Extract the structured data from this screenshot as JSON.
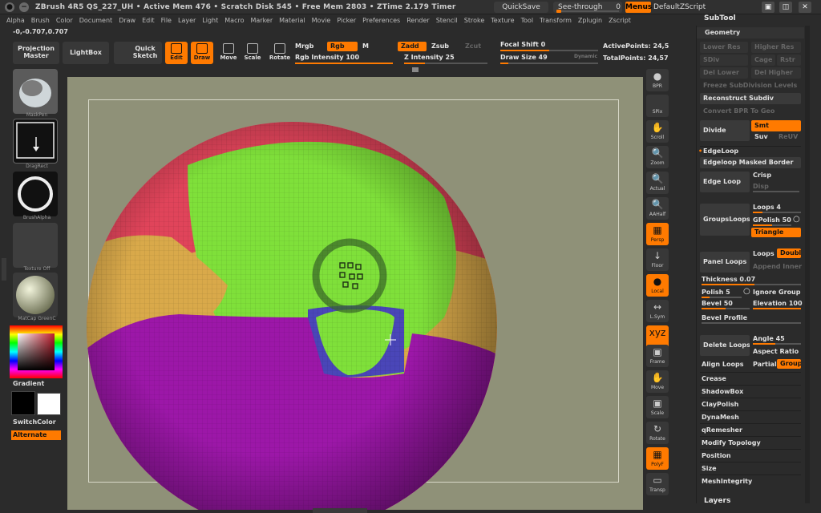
{
  "titlebar": {
    "title": "ZBrush 4R5   QS_227_UH  • Active Mem 476 • Scratch Disk 545 • Free Mem 2803 • ZTime 2.179 Timer",
    "quicksave": "QuickSave",
    "seethrough_label": "See-through",
    "seethrough_value": "0",
    "seethrough_level": 0,
    "menus": "Menus",
    "default_script": "DefaultZScript"
  },
  "menubar": [
    "Alpha",
    "Brush",
    "Color",
    "Document",
    "Draw",
    "Edit",
    "File",
    "Layer",
    "Light",
    "Macro",
    "Marker",
    "Material",
    "Movie",
    "Picker",
    "Preferences",
    "Render",
    "Stencil",
    "Stroke",
    "Texture",
    "Tool",
    "Transform",
    "Zplugin",
    "Zscript"
  ],
  "subtool_header": "SubTool",
  "coords": "-0,-0.707,0.707",
  "toolbar": {
    "projection_master": "Projection Master",
    "lightbox": "LightBox",
    "quick_sketch": "Quick Sketch",
    "edit": "Edit",
    "draw": "Draw",
    "move": "Move",
    "scale": "Scale",
    "rotate": "Rotate",
    "mrgb": "Mrgb",
    "rgb": "Rgb",
    "m": "M",
    "zadd": "Zadd",
    "zsub": "Zsub",
    "zcut": "Zcut",
    "rgb_intensity_label": "Rgb Intensity",
    "rgb_intensity": "100",
    "rgb_intensity_fraction": 1.0,
    "z_intensity_label": "Z Intensity",
    "z_intensity": "25",
    "z_intensity_fraction": 0.25,
    "focal_shift_label": "Focal Shift",
    "focal_shift": "0",
    "focal_shift_fraction": 0.5,
    "draw_size_label": "Draw Size",
    "draw_size": "49",
    "draw_size_fraction": 0.08,
    "dynamic": "Dynamic",
    "active_points_label": "ActivePoints:",
    "active_points": "24,5",
    "total_points_label": "TotalPoints:",
    "total_points": "24,57"
  },
  "left_shelf": {
    "brush_label": "MaskPen",
    "stroke_label": "DragRect",
    "alpha_label": "BrushAlpha",
    "texture_label": "Texture Off",
    "material_label": "MatCap GreenC",
    "gradient": "Gradient",
    "switchcolor": "SwitchColor",
    "alternate": "Alternate"
  },
  "right_shelf": [
    {
      "glyph": "●",
      "label": "BPR",
      "orange": false
    },
    {
      "glyph": "",
      "label": "SPix",
      "orange": false
    },
    {
      "glyph": "✋",
      "label": "Scroll",
      "orange": false
    },
    {
      "glyph": "🔍",
      "label": "Zoom",
      "orange": false
    },
    {
      "glyph": "🔍",
      "label": "Actual",
      "orange": false
    },
    {
      "glyph": "🔍",
      "label": "AAHalf",
      "orange": false
    },
    {
      "glyph": "▦",
      "label": "Persp",
      "orange": true
    },
    {
      "glyph": "↓",
      "label": "Floor",
      "orange": false
    },
    {
      "glyph": "●",
      "label": "Local",
      "orange": true
    },
    {
      "glyph": "↔",
      "label": "L.Sym",
      "orange": false
    },
    {
      "glyph": "xyz",
      "label": "",
      "orange": true
    },
    {
      "glyph": "▣",
      "label": "Frame",
      "orange": false
    },
    {
      "glyph": "✋",
      "label": "Move",
      "orange": false
    },
    {
      "glyph": "▣",
      "label": "Scale",
      "orange": false
    },
    {
      "glyph": "↻",
      "label": "Rotate",
      "orange": false
    },
    {
      "glyph": "▦",
      "label": "PolyF",
      "orange": true
    },
    {
      "glyph": "▭",
      "label": "Transp",
      "orange": false
    }
  ],
  "panel": {
    "geometry": "Geometry",
    "lower_res": "Lower Res",
    "higher_res": "Higher Res",
    "sdiv": "SDiv",
    "cage": "Cage",
    "rstr": "Rstr",
    "del_lower": "Del Lower",
    "del_higher": "Del Higher",
    "freeze": "Freeze SubDivision Levels",
    "reconstruct": "Reconstruct Subdiv",
    "convert_bpr": "Convert BPR To Geo",
    "divide": "Divide",
    "smt": "Smt",
    "suv": "Suv",
    "reuv": "ReUV",
    "edgeloop": "EdgeLoop",
    "edgeloop_masked": "Edgeloop Masked Border",
    "edge_loop": "Edge Loop",
    "crisp": "Crisp",
    "disp": "Disp",
    "groupsloops": "GroupsLoops",
    "loops_label": "Loops",
    "loops": "4",
    "gpolish_label": "GPolish",
    "gpolish": "50",
    "triangle": "Triangle",
    "panel_loops": "Panel Loops",
    "loops2_label": "Loops",
    "double": "Double",
    "append_inner": "Append Inner",
    "thickness_label": "Thickness",
    "thickness": "0.07",
    "polish_label": "Polish",
    "polish": "5",
    "ignore_groups": "Ignore Group",
    "bevel_label": "Bevel",
    "bevel": "50",
    "elevation_label": "Elevation",
    "elevation": "100",
    "bevel_profile": "Bevel Profile",
    "delete_loops": "Delete Loops",
    "angle_label": "Angle",
    "angle": "45",
    "aspect_ratio": "Aspect Ratio",
    "align_loops": "Align Loops",
    "partial": "Partial",
    "groups": "Groups",
    "crease": "Crease",
    "shadowbox": "ShadowBox",
    "claypolish": "ClayPolish",
    "dynamesh": "DynaMesh",
    "qremesher": "qRemesher",
    "modify_topology": "Modify Topology",
    "position": "Position",
    "size": "Size",
    "meshintegrity": "MeshIntegrity"
  },
  "layers": "Layers",
  "colors": {
    "accent": "#ff7a00",
    "canvas": "#8f9178",
    "sphere_red": "#e0445a",
    "sphere_green": "#7fe03a",
    "sphere_yellow": "#d9a94a",
    "sphere_purple": "#9c17a8",
    "sphere_blue": "#4a46b8"
  }
}
